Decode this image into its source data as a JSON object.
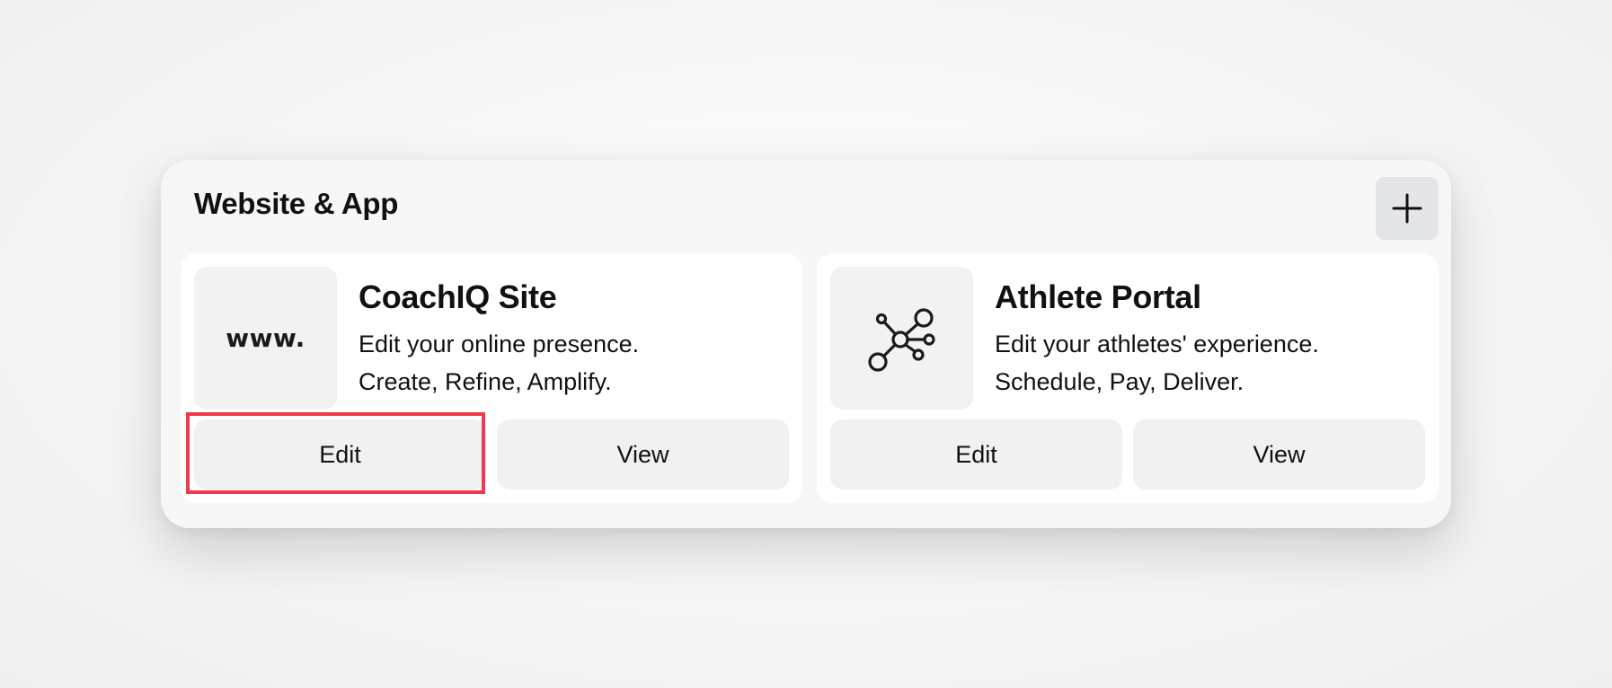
{
  "panel": {
    "title": "Website & App",
    "add_button": {
      "icon": "plus-icon"
    }
  },
  "cards": [
    {
      "thumbnail_text": "www.",
      "title": "CoachIQ Site",
      "line1": "Edit your online presence.",
      "line2": "Create, Refine, Amplify.",
      "edit_label": "Edit",
      "view_label": "View"
    },
    {
      "thumbnail_icon": "network-nodes-icon",
      "title": "Athlete Portal",
      "line1": "Edit your athletes' experience.",
      "line2": "Schedule, Pay, Deliver.",
      "edit_label": "Edit",
      "view_label": "View"
    }
  ],
  "colors": {
    "panel_bg": "#f7f7f7",
    "card_bg": "#ffffff",
    "button_bg": "#f1f1f1",
    "add_button_bg": "#e3e5e8",
    "highlight": "#f0394a",
    "text": "#111111"
  }
}
